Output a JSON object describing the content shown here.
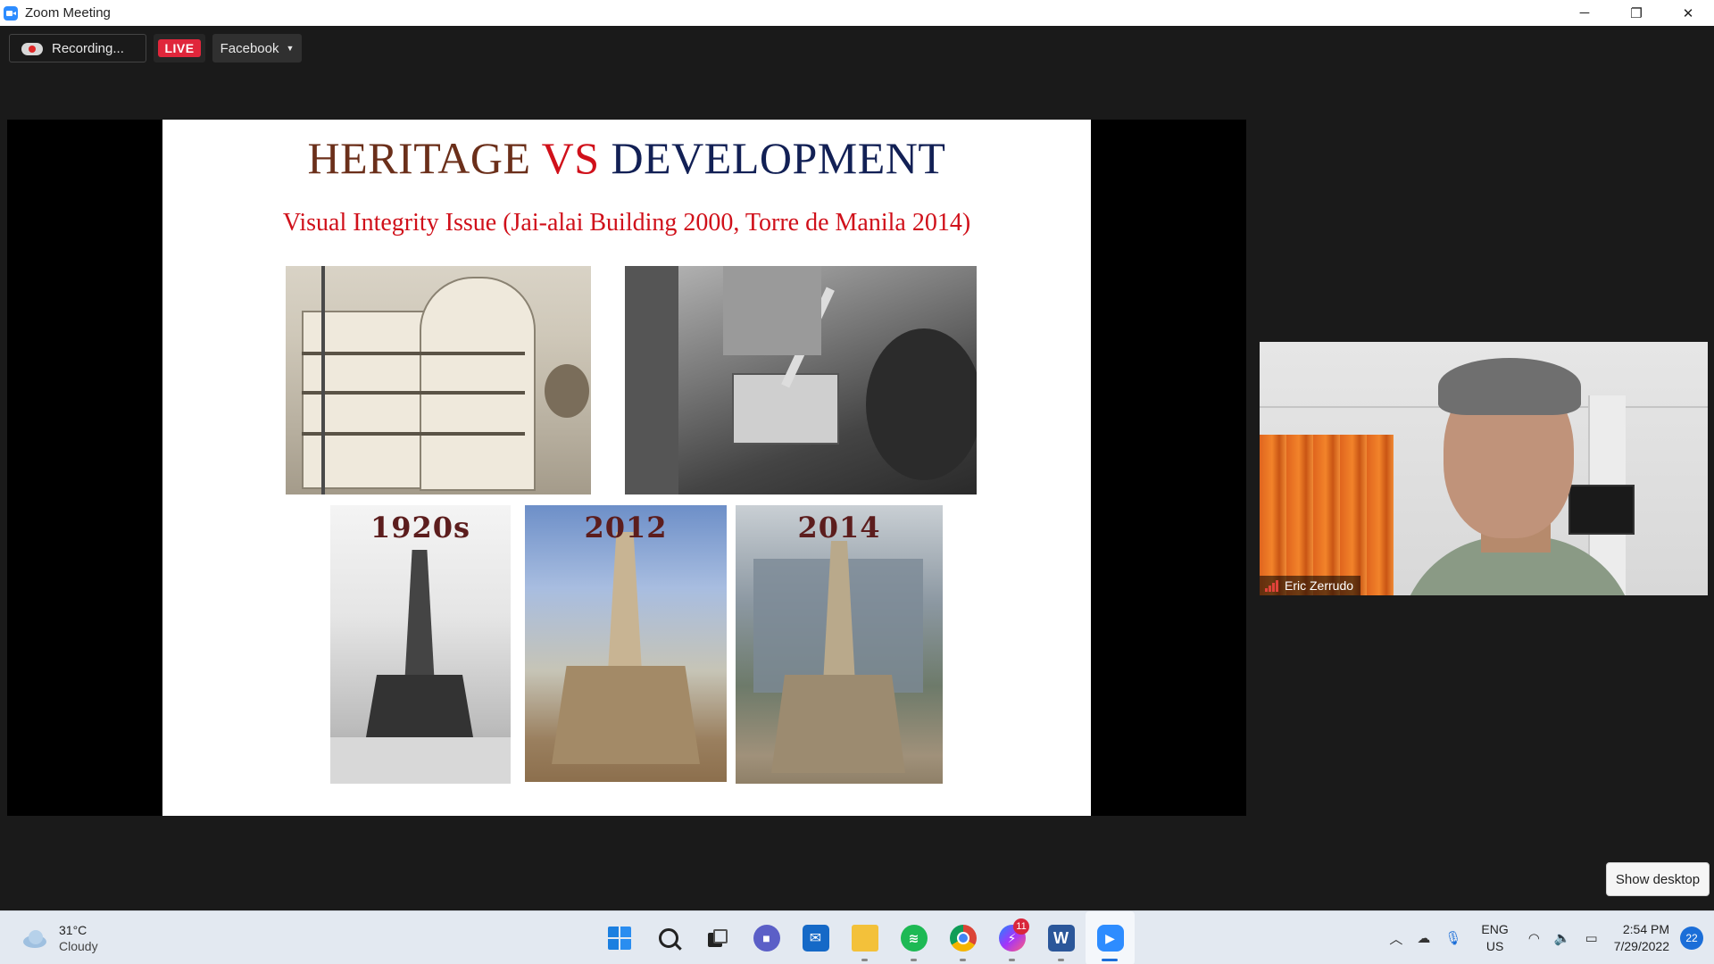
{
  "window": {
    "title": "Zoom Meeting",
    "controls": {
      "minimize": "─",
      "restore": "❐",
      "close": "✕"
    }
  },
  "meeting_controls": {
    "recording_label": "Recording...",
    "live_label": "LIVE",
    "stream_target": "Facebook"
  },
  "slide": {
    "title_part1": "HERITAGE",
    "title_part2": "VS",
    "title_part3": "DEVELOPMENT",
    "subtitle": "Visual Integrity Issue (Jai-alai Building 2000, Torre de Manila 2014)",
    "years": [
      "1920s",
      "2012",
      "2014"
    ]
  },
  "participant": {
    "name": "Eric Zerrudo"
  },
  "tooltip": {
    "show_desktop": "Show desktop"
  },
  "taskbar": {
    "weather": {
      "temp": "31°C",
      "condition": "Cloudy"
    },
    "apps": [
      {
        "name": "Start"
      },
      {
        "name": "Search"
      },
      {
        "name": "Task View"
      },
      {
        "name": "Chat"
      },
      {
        "name": "Mail"
      },
      {
        "name": "File Explorer"
      },
      {
        "name": "Spotify"
      },
      {
        "name": "Chrome"
      },
      {
        "name": "Messenger",
        "badge": "11"
      },
      {
        "name": "Word"
      },
      {
        "name": "Zoom"
      }
    ],
    "tray": {
      "lang_line1": "ENG",
      "lang_line2": "US",
      "time": "2:54 PM",
      "date": "7/29/2022",
      "notifications": "22"
    }
  },
  "colors": {
    "heritage": "#6b2f1a",
    "vs": "#d0101a",
    "development": "#122055",
    "live_red": "#e0263b",
    "zoom_blue": "#2d8cff"
  }
}
